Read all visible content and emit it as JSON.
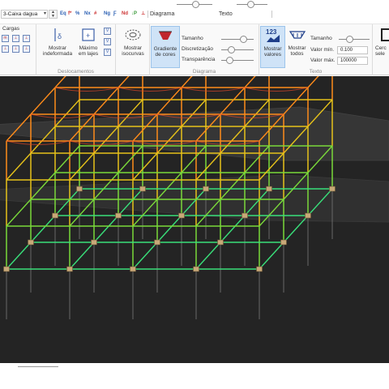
{
  "topbar": {
    "view_selector": "3-Caixa dagua",
    "quick_icons": [
      "quick-icon-1",
      "quick-icon-2",
      "quick-icon-3",
      "quick-icon-4",
      "quick-icon-5",
      "quick-icon-6",
      "quick-icon-7",
      "quick-icon-8"
    ],
    "diagram_label": "Diagrama",
    "diagram_slider": 0.55,
    "text_label": "Texto",
    "text_slider": 0.45
  },
  "ribbon": {
    "cargas": {
      "title": "Cargas"
    },
    "deslocamentos": {
      "title": "Deslocamentos",
      "show_undeformed": "Mostrar\nindeformada",
      "max_in_slabs": "Máximo\nem lajes"
    },
    "isocurvas": {
      "label": "Mostrar\nisocurvas"
    },
    "diagrama": {
      "title": "Diagrama",
      "color_gradient": "Gradiente\nde cores",
      "size_label": "Tamanho",
      "size_value": 0.75,
      "discretization_label": "Discretização",
      "discretization_value": 0.25,
      "transparency_label": "Transparência",
      "transparency_value": 0.2
    },
    "texto": {
      "title": "Texto",
      "value_badge": "123",
      "show_values": "Mostrar\nvalores",
      "show_all": "Mostrar\ntodos",
      "size_label": "Tamanho",
      "size_value": 0.3,
      "min_label": "Valor mín.",
      "min_value": "0.100",
      "max_label": "Valor máx.",
      "max_value": "100000"
    },
    "last_button": "Cerc\nsele"
  },
  "colors": {
    "background": "#242424",
    "top_beams": "#ff8c1a",
    "mid_beams": "#e6c21a",
    "lower_columns": "#7ad93a",
    "base_grid": "#39e07a",
    "supports": "#c8a878",
    "ghost": "#6b6b6b",
    "ribbon_active": "#cfe3f7"
  }
}
